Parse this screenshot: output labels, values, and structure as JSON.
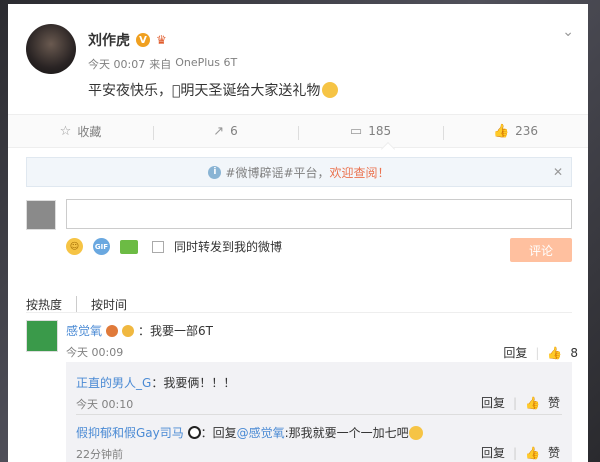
{
  "post": {
    "username": "刘作虎",
    "vbadge": "V",
    "time": "今天 00:07",
    "source_prefix": "来自",
    "source": "OnePlus 6T",
    "content": "平安夜快乐，\u0000明天圣诞给大家送礼物"
  },
  "actions": [
    {
      "icon": "☆",
      "label": "收藏"
    },
    {
      "icon": "↗",
      "label": "6"
    },
    {
      "icon": "▭",
      "label": "185"
    },
    {
      "icon": "👍",
      "label": "236"
    }
  ],
  "notice": {
    "text_gray": "#微博辟谣#平台，",
    "text_link": "欢迎查阅！"
  },
  "composer": {
    "input_value": "",
    "repost_label": "同时转发到我的微博",
    "submit_label": "评论"
  },
  "sort": {
    "hot": "按热度",
    "time": "按时间"
  },
  "comment": {
    "nick": "感觉氧",
    "text": "：我要一部6T",
    "time": "今天 00:09",
    "reply_label": "回复",
    "like_count": "8"
  },
  "replies": [
    {
      "nick": "正直的男人_G",
      "text": "：我要俩！！！",
      "time": "今天 00:10",
      "reply_label": "回复",
      "like_label": "赞"
    },
    {
      "nick": "假抑郁和假Gay司马",
      "text_prefix": "：回复",
      "mention": "@感觉氧",
      "text": ":那我就要一个一加七吧",
      "time": "22分钟前",
      "reply_label": "回复",
      "like_label": "赞"
    }
  ],
  "colors": {
    "accent": "#eb7350",
    "link": "#4a8ad4",
    "submit_disabled": "#ffc09f"
  }
}
